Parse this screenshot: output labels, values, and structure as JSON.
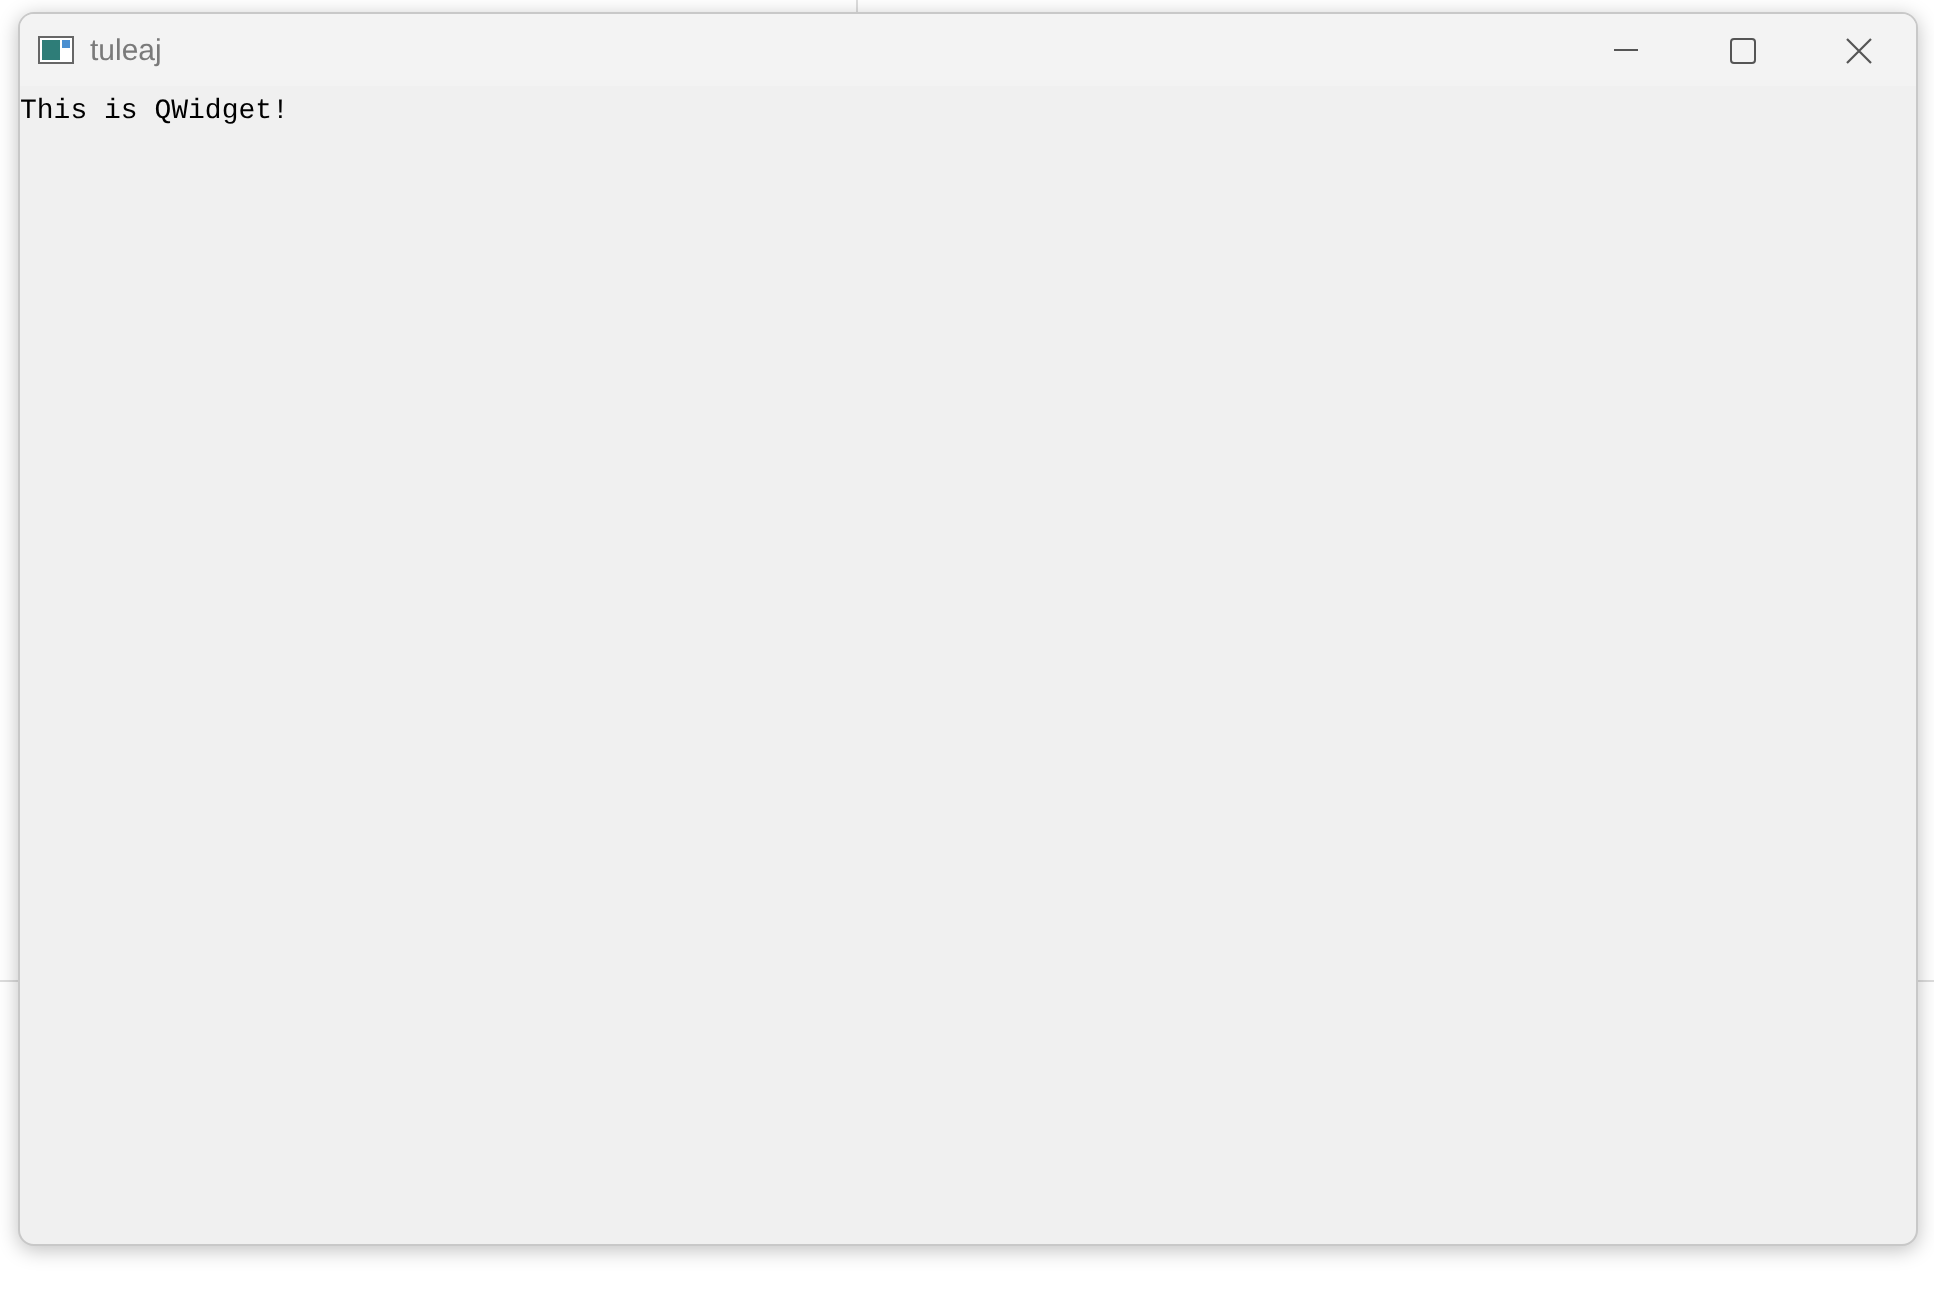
{
  "window": {
    "title": "tuleaj",
    "label": "This is QWidget!"
  }
}
